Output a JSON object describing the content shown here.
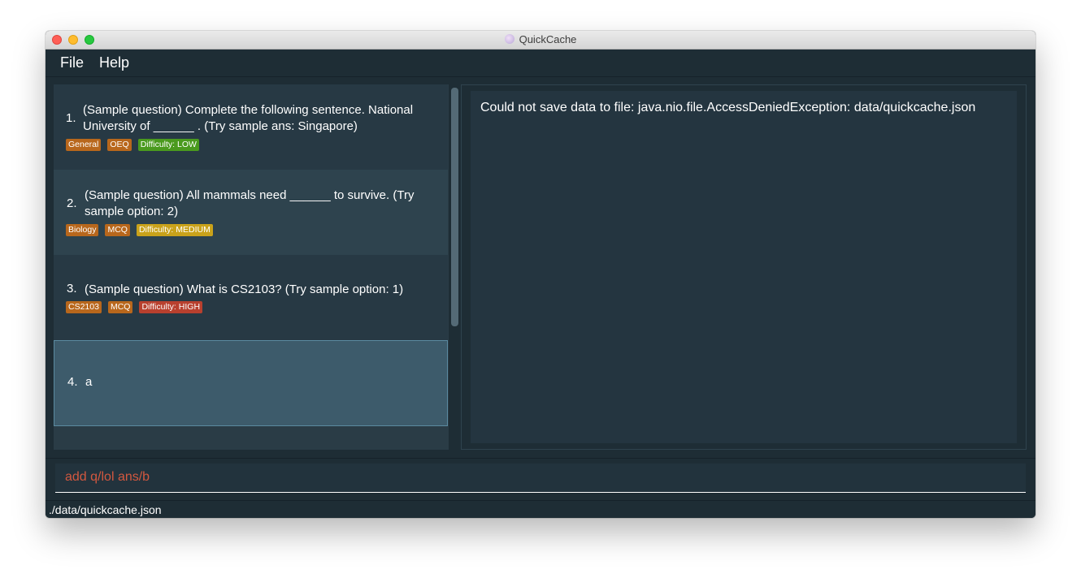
{
  "window": {
    "title": "QuickCache"
  },
  "menu": {
    "file": "File",
    "help": "Help"
  },
  "questions": [
    {
      "index": "1.",
      "text": "(Sample question) Complete the following sentence. National University of ______ . (Try sample ans: Singapore)",
      "tags": [
        {
          "label": "General",
          "color": "#b8671c"
        },
        {
          "label": "OEQ",
          "color": "#b8671c"
        },
        {
          "label": "Difficulty: LOW",
          "color": "#4a9a1e"
        }
      ]
    },
    {
      "index": "2.",
      "text": "(Sample question) All mammals need ______ to survive. (Try sample option: 2)",
      "tags": [
        {
          "label": "Biology",
          "color": "#b8671c"
        },
        {
          "label": "MCQ",
          "color": "#b8671c"
        },
        {
          "label": "Difficulty: MEDIUM",
          "color": "#c9a21a"
        }
      ]
    },
    {
      "index": "3.",
      "text": "(Sample question) What is CS2103? (Try sample option: 1)",
      "tags": [
        {
          "label": "CS2103",
          "color": "#b8671c"
        },
        {
          "label": "MCQ",
          "color": "#b8671c"
        },
        {
          "label": "Difficulty: HIGH",
          "color": "#b8402e"
        }
      ]
    },
    {
      "index": "4.",
      "text": "a",
      "tags": []
    }
  ],
  "result": {
    "message": "Could not save data to file: java.nio.file.AccessDeniedException: data/quickcache.json"
  },
  "command": {
    "value": "add q/lol ans/b",
    "color": "#d3583f"
  },
  "status": {
    "path": "./data/quickcache.json"
  }
}
